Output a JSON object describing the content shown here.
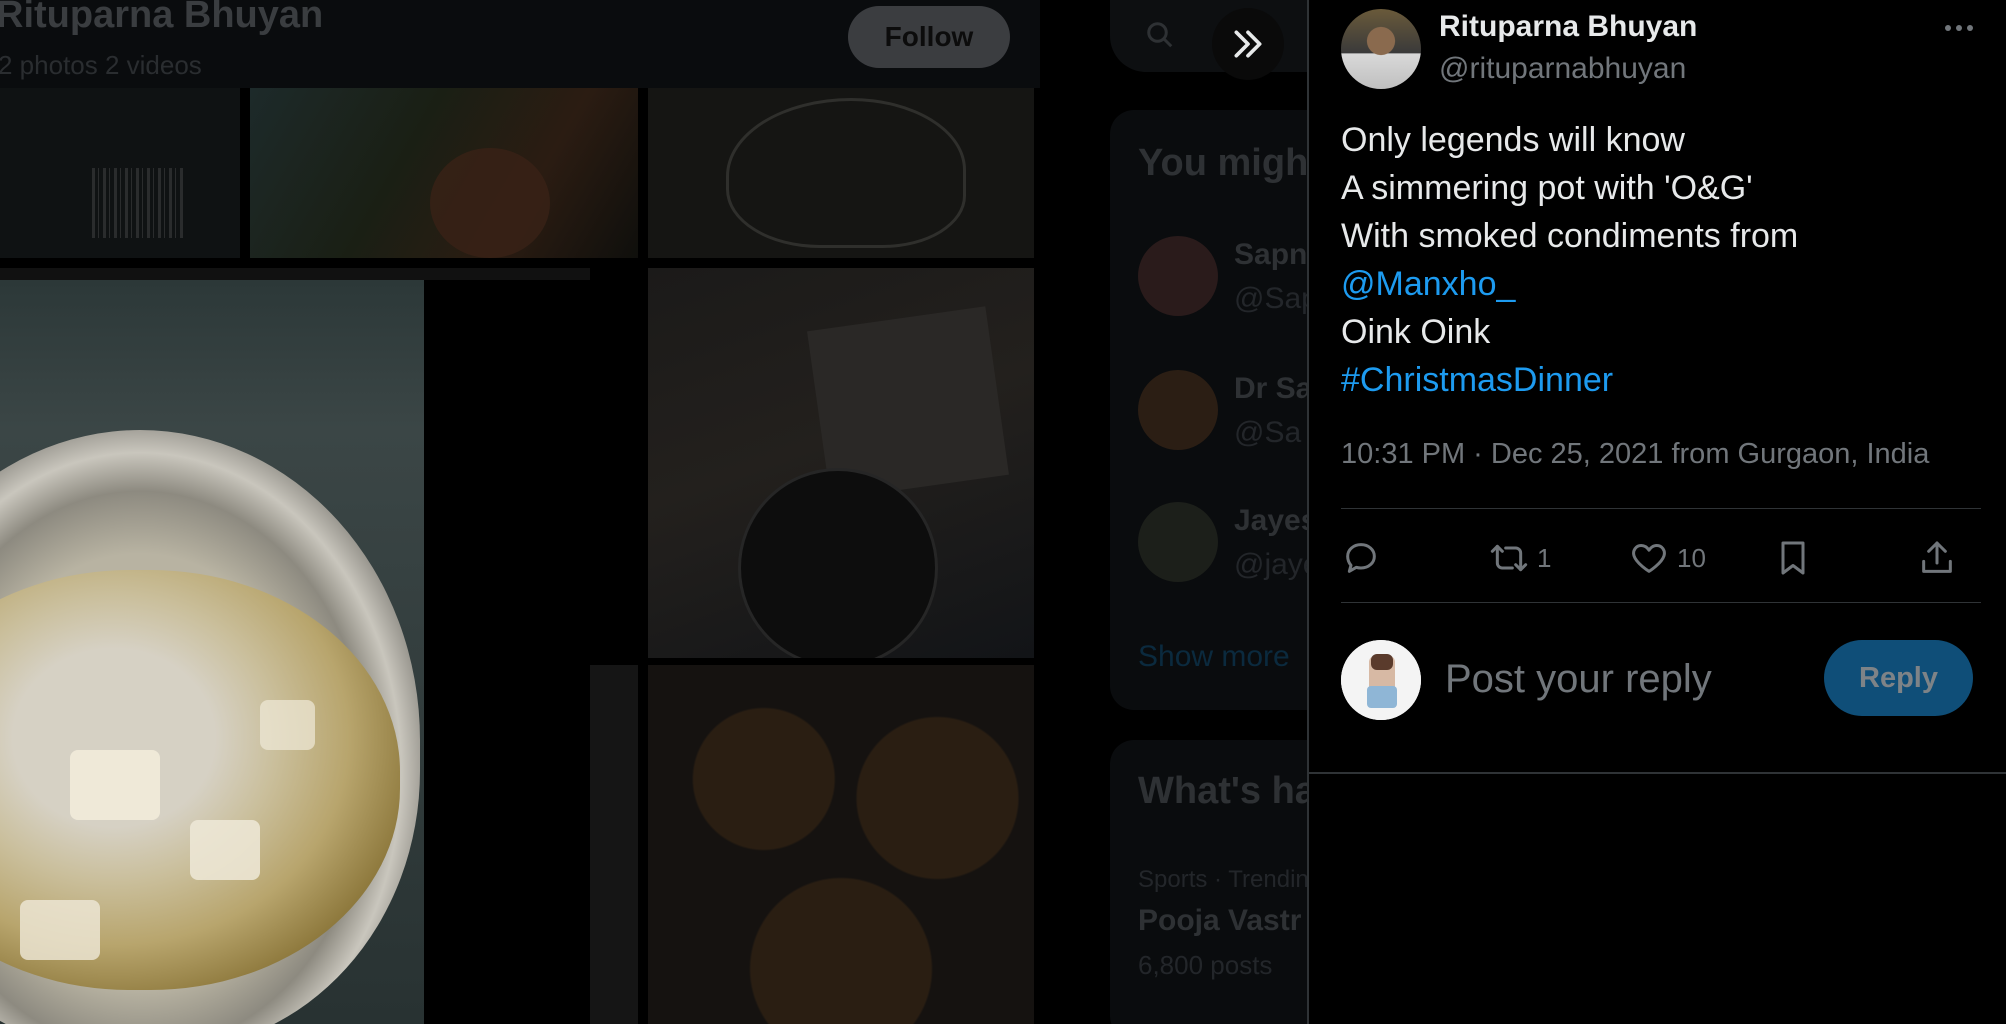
{
  "background": {
    "profile_name": "Rituparna Bhuyan",
    "profile_counts": "2 photos 2 videos",
    "follow_label": "Follow",
    "right_column": {
      "you_might_like_heading": "You might like",
      "suggestions": [
        {
          "name": "Sapna",
          "handle": "@Sapna"
        },
        {
          "name": "Dr Sa",
          "handle": "@Sa"
        },
        {
          "name": "Jayesh",
          "handle": "@jaye"
        }
      ],
      "show_more": "Show more",
      "whats_happening_heading": "What's happening",
      "trend_context": "Sports · Trending",
      "trend_name": "Pooja Vastr",
      "trend_posts": "6,800 posts"
    }
  },
  "tweet": {
    "author_name": "Rituparna Bhuyan",
    "author_handle": "@rituparnabhuyan",
    "lines": [
      {
        "text": "Only legends will know",
        "link": false
      },
      {
        "text": "A simmering pot with 'O&G'",
        "link": false
      },
      {
        "text": "With smoked condiments from",
        "link": false
      },
      {
        "text": "@Manxho_",
        "link": true
      },
      {
        "text": "Oink Oink",
        "link": false
      },
      {
        "text": "#ChristmasDinner",
        "link": true
      }
    ],
    "timestamp": "10:31 PM · Dec 25, 2021 from Gurgaon, India",
    "stats": {
      "retweets": "1",
      "likes": "10"
    }
  },
  "reply_box": {
    "placeholder": "Post your reply",
    "button_label": "Reply"
  },
  "colors": {
    "accent": "#1d9bf0",
    "text_primary": "#e7e9ea",
    "text_secondary": "#71767b",
    "divider": "#2f3336",
    "reply_button_bg": "#0f4e78"
  },
  "icons": {
    "collapse": "double-chevron-right-icon",
    "more": "more-horizontal-icon",
    "reply": "reply-icon",
    "retweet": "retweet-icon",
    "like": "heart-icon",
    "bookmark": "bookmark-icon",
    "share": "share-icon",
    "search": "search-icon"
  }
}
